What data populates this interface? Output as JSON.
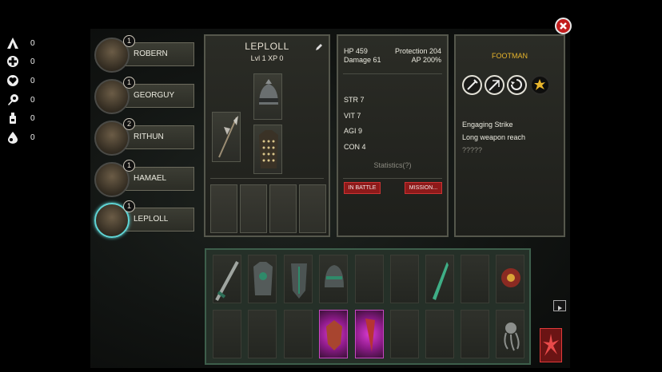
{
  "resources": [
    {
      "icon": "tent-icon",
      "value": "0"
    },
    {
      "icon": "medical-cross-icon",
      "value": "0"
    },
    {
      "icon": "heart-icon",
      "value": "0"
    },
    {
      "icon": "torch-icon",
      "value": "0"
    },
    {
      "icon": "bottle-icon",
      "value": "0"
    },
    {
      "icon": "blood-drop-icon",
      "value": "0"
    }
  ],
  "heroes": [
    {
      "name": "ROBERN",
      "level": "1"
    },
    {
      "name": "GEORGUY",
      "level": "1"
    },
    {
      "name": "RITHUN",
      "level": "2"
    },
    {
      "name": "HAMAEL",
      "level": "1"
    },
    {
      "name": "LEPLOLL",
      "level": "1"
    }
  ],
  "equipment": {
    "hero_name": "LEPLOLL",
    "level_line": "Lvl 1  XP 0"
  },
  "stats": {
    "hp": "HP 459",
    "protection": "Protection 204",
    "damage": "Damage 61",
    "ap": "AP 200%",
    "str": "STR 7",
    "vit": "VIT 7",
    "agi": "AGI 9",
    "con": "CON 4",
    "statistics_label": "Statistics(?)",
    "in_battle_label": "IN BATTLE",
    "mission_label": "MISSION..."
  },
  "hero_class": {
    "title": "FOOTMAN",
    "skill_name": "Engaging Strike",
    "skill_desc": "Long weapon reach",
    "skill_extra": "?????"
  },
  "colors": {
    "accent_gold": "#e8b52c",
    "selected_ring": "#5fd4d4",
    "action_red": "#8e1a1a",
    "glow_magenta": "#d83ad0"
  }
}
